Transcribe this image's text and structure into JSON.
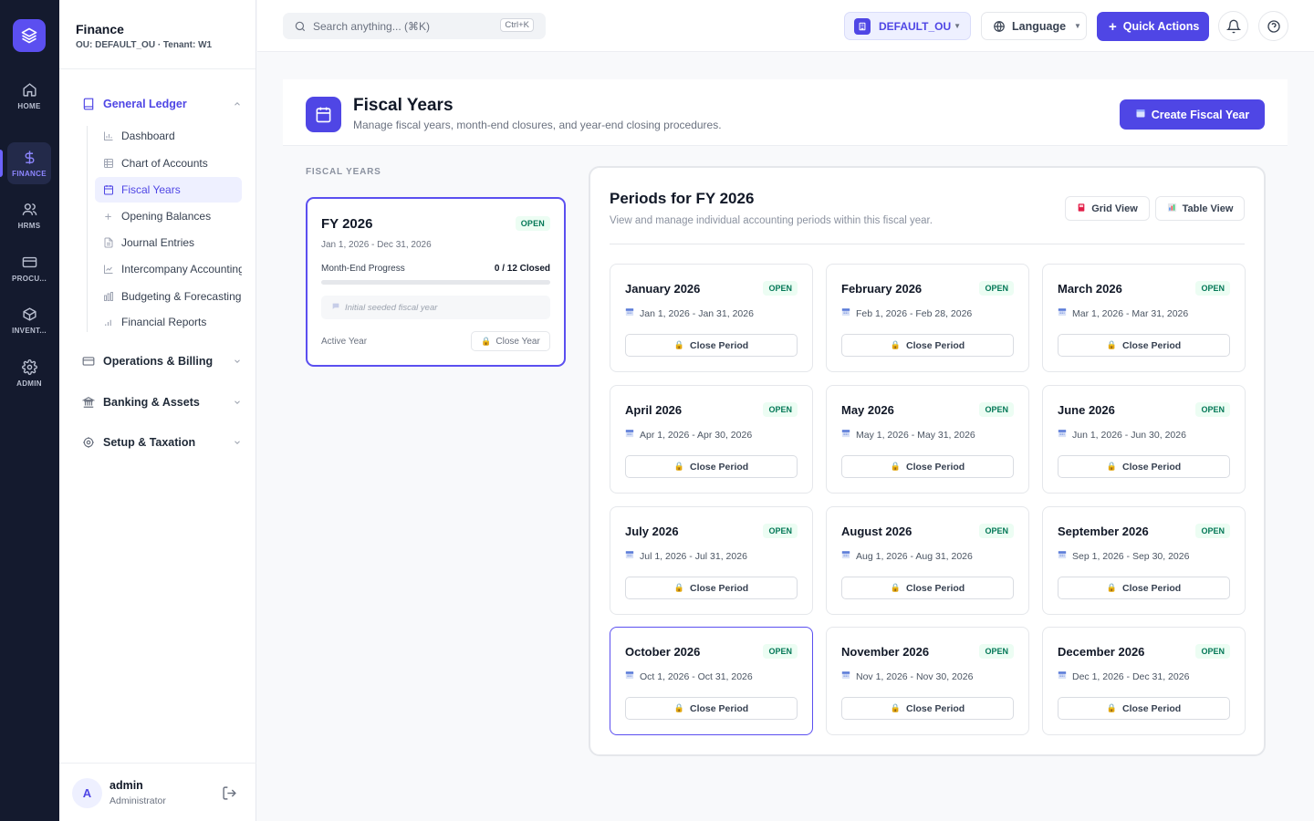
{
  "rail": {
    "items": [
      {
        "label": "HOME",
        "icon": "home-icon"
      },
      {
        "label": "FINANCE",
        "icon": "dollar-icon"
      },
      {
        "label": "HRMS",
        "icon": "users-icon"
      },
      {
        "label": "PROCU...",
        "icon": "credit-card-icon"
      },
      {
        "label": "INVENT...",
        "icon": "box-icon"
      },
      {
        "label": "ADMIN",
        "icon": "gear-icon"
      }
    ],
    "active": "FINANCE"
  },
  "sidebar": {
    "title": "Finance",
    "subtitle": "OU: DEFAULT_OU · Tenant: W1",
    "groups": [
      {
        "label": "General Ledger",
        "icon": "book-icon",
        "expanded": true
      },
      {
        "label": "Operations & Billing",
        "icon": "card-icon",
        "expanded": false
      },
      {
        "label": "Banking & Assets",
        "icon": "bank-icon",
        "expanded": false
      },
      {
        "label": "Setup & Taxation",
        "icon": "gear-icon",
        "expanded": false
      }
    ],
    "items": [
      {
        "label": "Dashboard",
        "icon": "bar-chart-icon"
      },
      {
        "label": "Chart of Accounts",
        "icon": "table-icon"
      },
      {
        "label": "Fiscal Years",
        "icon": "calendar-icon"
      },
      {
        "label": "Opening Balances",
        "icon": "plus-icon"
      },
      {
        "label": "Journal Entries",
        "icon": "document-icon"
      },
      {
        "label": "Intercompany Accounting",
        "icon": "trend-icon"
      },
      {
        "label": "Budgeting & Forecasting",
        "icon": "budget-icon"
      },
      {
        "label": "Financial Reports",
        "icon": "signal-icon"
      }
    ],
    "active_item": "Fiscal Years",
    "user": {
      "initial": "A",
      "name": "admin",
      "role": "Administrator"
    }
  },
  "topbar": {
    "search_placeholder": "Search anything... (⌘K)",
    "search_shortcut": "Ctrl+K",
    "ou_label": "DEFAULT_OU",
    "language_label": "Language",
    "quick_actions_label": "Quick Actions"
  },
  "page": {
    "title": "Fiscal Years",
    "subtitle": "Manage fiscal years, month-end closures, and year-end closing procedures.",
    "create_button": "Create Fiscal Year"
  },
  "fiscal_years": {
    "section_label": "FISCAL YEARS",
    "cards": [
      {
        "name": "FY 2026",
        "status": "OPEN",
        "dates": "Jan 1, 2026 - Dec 31, 2026",
        "progress_label": "Month-End Progress",
        "progress_value": "0 / 12 Closed",
        "progress_fraction": 0,
        "note": "Initial seeded fiscal year",
        "active_label": "Active Year",
        "close_button": "Close Year"
      }
    ]
  },
  "periods": {
    "title": "Periods for FY 2026",
    "subtitle": "View and manage individual accounting periods within this fiscal year.",
    "grid_view_label": "Grid View",
    "table_view_label": "Table View",
    "close_label": "Close Period",
    "selected": "October 2026",
    "list": [
      {
        "name": "January 2026",
        "status": "OPEN",
        "dates": "Jan 1, 2026 - Jan 31, 2026"
      },
      {
        "name": "February 2026",
        "status": "OPEN",
        "dates": "Feb 1, 2026 - Feb 28, 2026"
      },
      {
        "name": "March 2026",
        "status": "OPEN",
        "dates": "Mar 1, 2026 - Mar 31, 2026"
      },
      {
        "name": "April 2026",
        "status": "OPEN",
        "dates": "Apr 1, 2026 - Apr 30, 2026"
      },
      {
        "name": "May 2026",
        "status": "OPEN",
        "dates": "May 1, 2026 - May 31, 2026"
      },
      {
        "name": "June 2026",
        "status": "OPEN",
        "dates": "Jun 1, 2026 - Jun 30, 2026"
      },
      {
        "name": "July 2026",
        "status": "OPEN",
        "dates": "Jul 1, 2026 - Jul 31, 2026"
      },
      {
        "name": "August 2026",
        "status": "OPEN",
        "dates": "Aug 1, 2026 - Aug 31, 2026"
      },
      {
        "name": "September 2026",
        "status": "OPEN",
        "dates": "Sep 1, 2026 - Sep 30, 2026"
      },
      {
        "name": "October 2026",
        "status": "OPEN",
        "dates": "Oct 1, 2026 - Oct 31, 2026"
      },
      {
        "name": "November 2026",
        "status": "OPEN",
        "dates": "Nov 1, 2026 - Nov 30, 2026"
      },
      {
        "name": "December 2026",
        "status": "OPEN",
        "dates": "Dec 1, 2026 - Dec 31, 2026"
      }
    ]
  },
  "colors": {
    "accent": "#4f46e5",
    "rail_bg": "#141a2e",
    "open_badge": "#047857"
  }
}
